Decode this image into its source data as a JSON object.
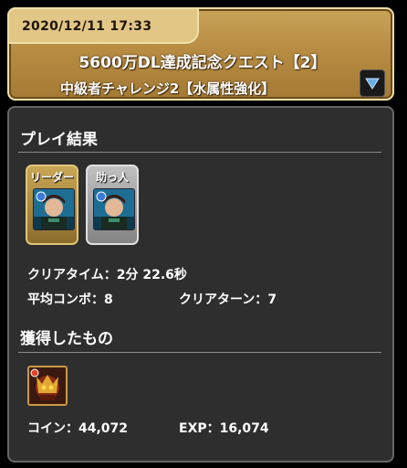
{
  "header": {
    "date": "2020/12/11 17:33",
    "quest_title": "5600万DL達成記念クエスト【2】",
    "dungeon_name": "中級者チャレンジ2【水属性強化】",
    "toggle_icon": "triangle-down-icon"
  },
  "results": {
    "section_title": "プレイ結果",
    "leader_label": "リーダー",
    "helper_label": "助っ人",
    "clear_time_label": "クリアタイム：",
    "clear_time_value": "2分 22.6秒",
    "avg_combo_label": "平均コンボ：",
    "avg_combo_value": "8",
    "clear_turns_label": "クリアターン：",
    "clear_turns_value": "7"
  },
  "rewards": {
    "section_title": "獲得したもの",
    "coin_label": "コイン：",
    "coin_value": "44,072",
    "exp_label": "EXP：",
    "exp_value": "16,074"
  },
  "colors": {
    "banner": "#b88c42",
    "leader_frame": "#c8a656",
    "helper_frame": "#c0c0c0",
    "panel": "#2e2e2e"
  }
}
